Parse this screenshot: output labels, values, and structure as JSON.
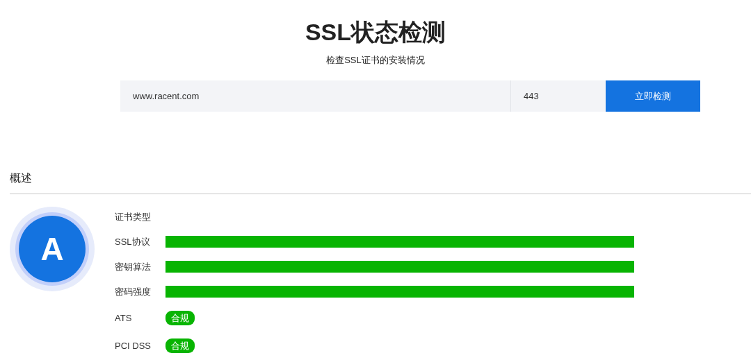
{
  "header": {
    "title": "SSL状态检测",
    "subtitle": "检查SSL证书的安装情况"
  },
  "form": {
    "domain": "www.racent.com",
    "port": "443",
    "button": "立即检测"
  },
  "overview": {
    "heading": "概述",
    "grade": "A",
    "rows": [
      {
        "kind": "text",
        "label": "证书类型"
      },
      {
        "kind": "bar",
        "label": "SSL协议"
      },
      {
        "kind": "bar",
        "label": "密钥算法"
      },
      {
        "kind": "bar",
        "label": "密码强度"
      },
      {
        "kind": "badge",
        "label": "ATS",
        "badge": "合规"
      },
      {
        "kind": "badge",
        "label": "PCI DSS",
        "badge": "合规"
      }
    ]
  }
}
